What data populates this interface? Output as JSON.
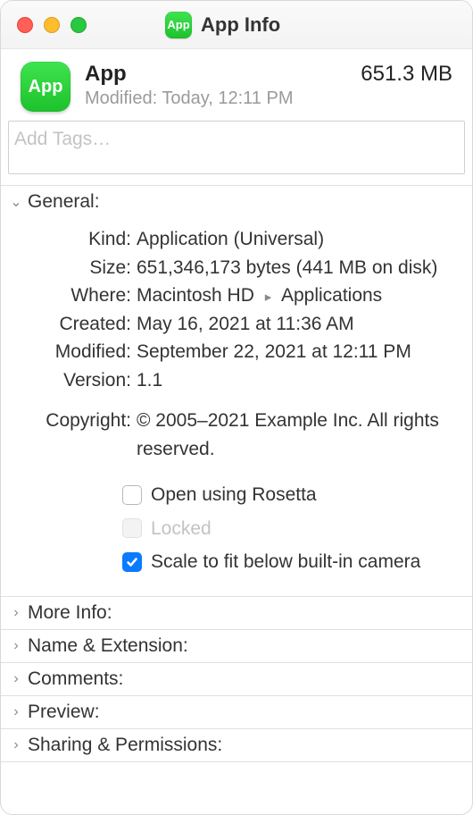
{
  "window": {
    "title": "App Info"
  },
  "traffic": {
    "close": "close",
    "minimize": "minimize",
    "zoom": "zoom"
  },
  "header": {
    "app_name": "App",
    "modified_label": "Modified:",
    "modified_value": "Today, 12:11 PM",
    "size": "651.3 MB",
    "icon_text": "App"
  },
  "tags": {
    "placeholder": "Add Tags…"
  },
  "general": {
    "title": "General:",
    "kind_label": "Kind:",
    "kind_value": "Application (Universal)",
    "size_label": "Size:",
    "size_value": "651,346,173 bytes (441 MB on disk)",
    "where_label": "Where:",
    "where_root": "Macintosh HD",
    "where_sep": "▸",
    "where_folder": "Applications",
    "created_label": "Created:",
    "created_value": "May 16, 2021 at 11:36 AM",
    "modified_label": "Modified:",
    "modified_value": "September 22, 2021 at 12:11 PM",
    "version_label": "Version:",
    "version_value": "1.1",
    "copyright_label": "Copyright:",
    "copyright_value": "© 2005–2021 Example Inc. All rights reserved.",
    "rosetta_label": "Open using Rosetta",
    "locked_label": "Locked",
    "scale_label": "Scale to fit below built-in camera"
  },
  "sections": {
    "more_info": "More Info:",
    "name_ext": "Name & Extension:",
    "comments": "Comments:",
    "preview": "Preview:",
    "sharing": "Sharing & Permissions:"
  }
}
